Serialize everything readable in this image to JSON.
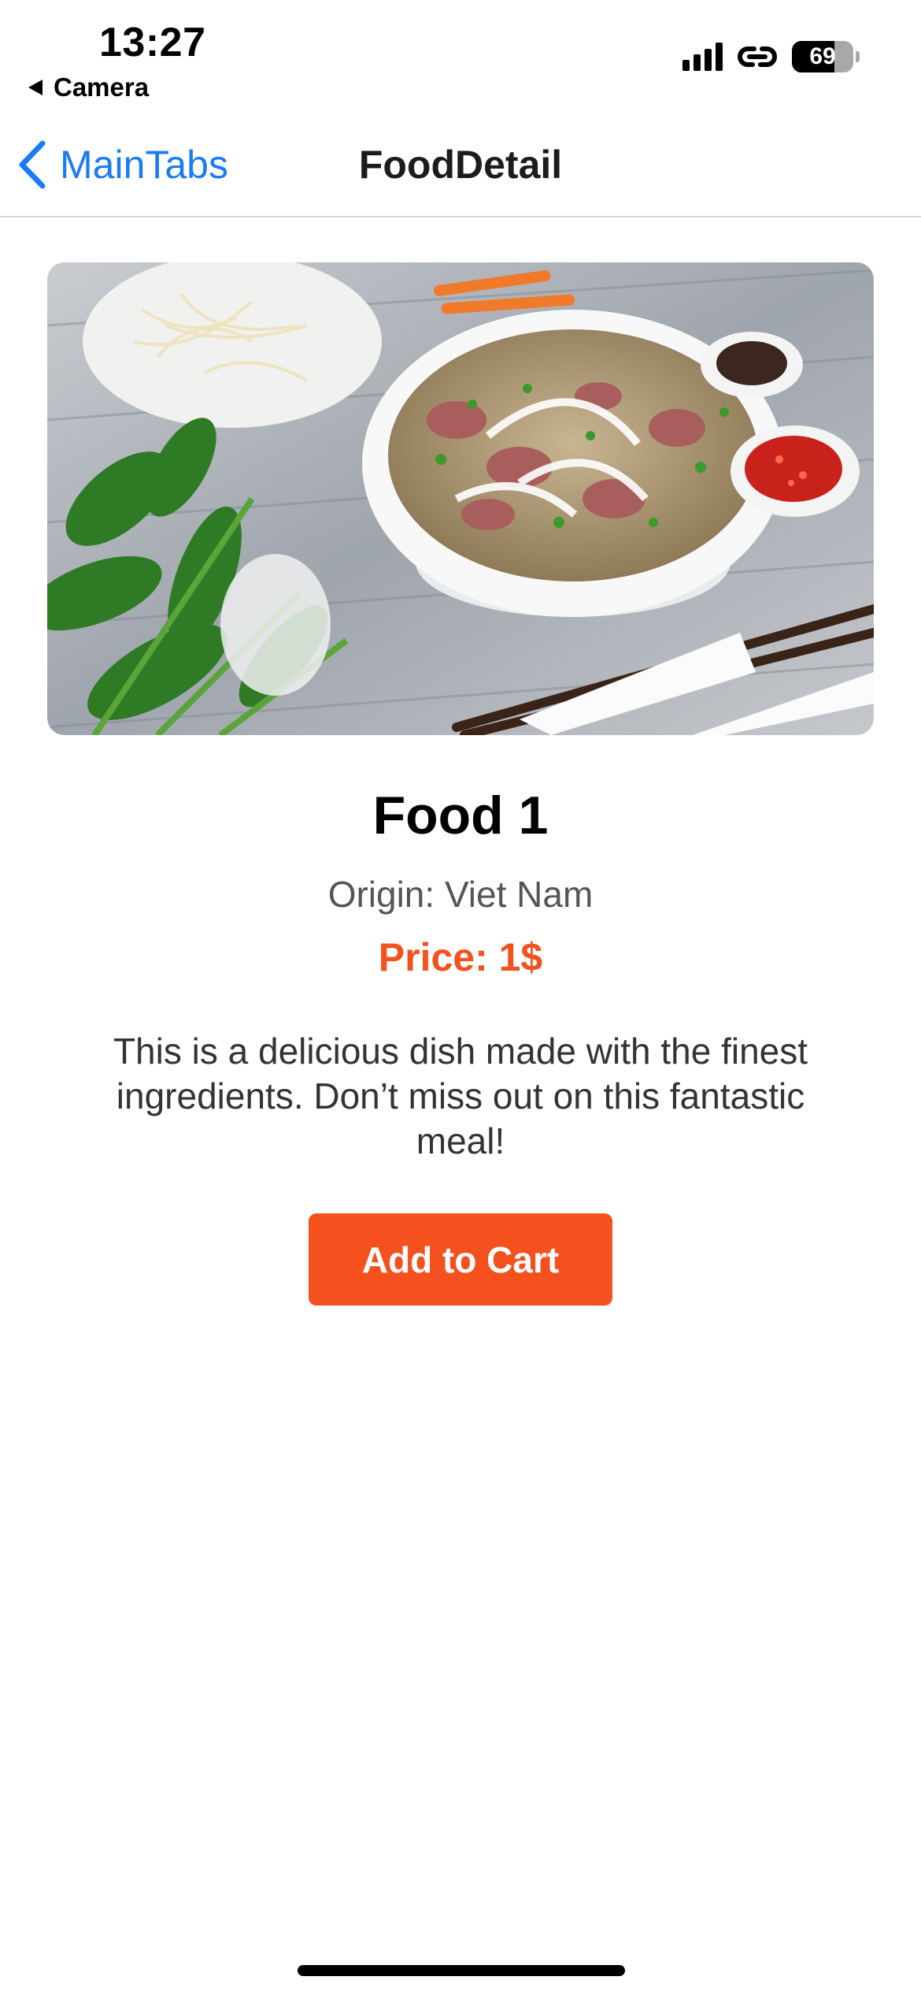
{
  "status_bar": {
    "time": "13:27",
    "back_app_label": "Camera",
    "battery_level": "69",
    "icons": [
      "cellular-signal-icon",
      "link-icon",
      "battery-icon"
    ]
  },
  "nav": {
    "back_label": "MainTabs",
    "title": "FoodDetail",
    "accent_color": "#1a7cf5"
  },
  "food": {
    "image_icon": "pho-bowl-photo",
    "name": "Food 1",
    "origin": "Origin: Viet Nam",
    "price": "Price: 1$",
    "description": "This is a delicious dish made with the finest ingredients. Don’t miss out on this fantastic meal!",
    "price_color": "#f4511e"
  },
  "actions": {
    "add_to_cart_label": "Add to Cart",
    "button_color": "#f4511e"
  }
}
